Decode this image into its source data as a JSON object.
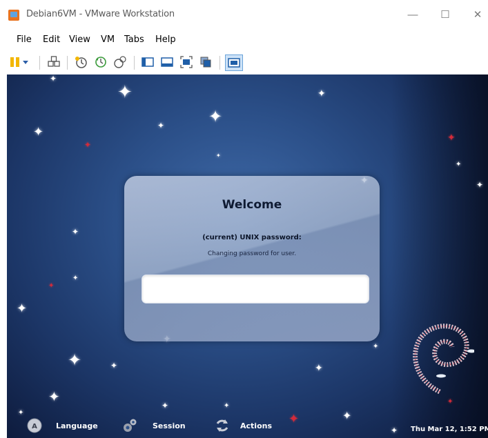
{
  "window": {
    "title": "Debian6VM - VMware Workstation",
    "minimize_glyph": "—",
    "maximize_glyph": "☐",
    "close_glyph": "✕"
  },
  "menu": {
    "items": [
      "File",
      "Edit",
      "View",
      "VM",
      "Tabs",
      "Help"
    ]
  },
  "toolbar": {
    "icons": [
      "pause-icon",
      "dropdown-arrow-icon",
      "send-keys-icon",
      "snapshot-icon",
      "revert-snapshot-icon",
      "snapshot-manager-icon",
      "console-view-icon",
      "thumbnail-view-icon",
      "fullscreen-icon",
      "unity-icon",
      "quick-switch-icon"
    ]
  },
  "login": {
    "title": "Welcome",
    "prompt": "(current) UNIX password:",
    "message": "Changing password for user.",
    "password_value": ""
  },
  "bottom_bar": {
    "language_label": "Language",
    "session_label": "Session",
    "actions_label": "Actions",
    "clock": "Thu Mar 12,  1:52 PM"
  },
  "colors": {
    "accent": "#e8731f",
    "desktop_bg": "#2b4f88"
  }
}
